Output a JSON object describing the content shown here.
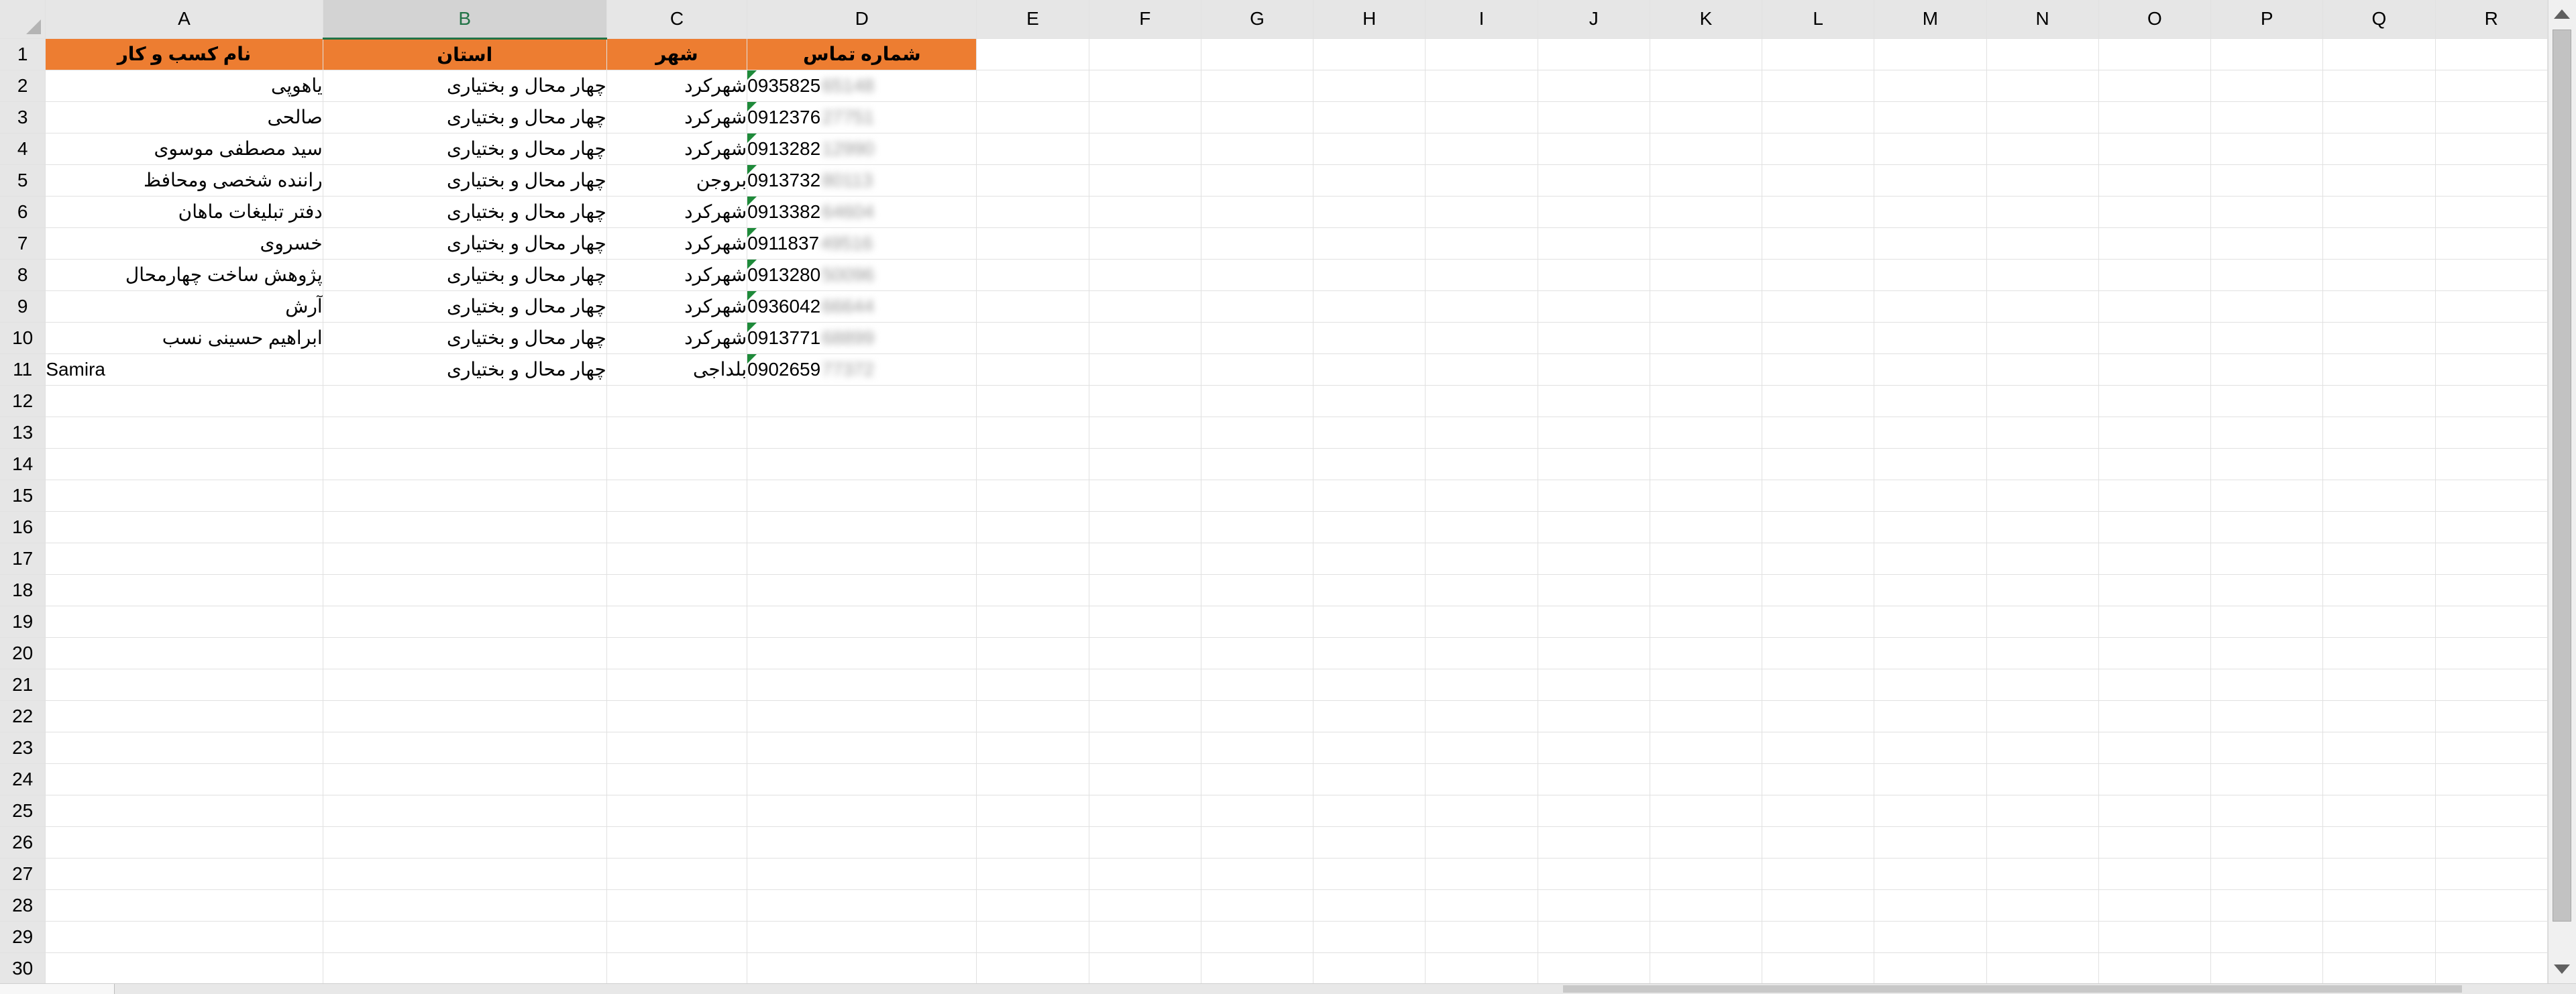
{
  "columns": [
    "A",
    "B",
    "C",
    "D",
    "E",
    "F",
    "G",
    "H",
    "I",
    "J",
    "K",
    "L",
    "M",
    "N",
    "O",
    "P",
    "Q",
    "R"
  ],
  "selected_column": "B",
  "header_row": {
    "business_name": "نام کسب و کار",
    "province": "استان",
    "city": "شهر",
    "phone": "شماره تماس"
  },
  "rows": [
    {
      "row": "2",
      "name": "یاهوپی",
      "province": "چهار محال و بختیاری",
      "city": "شهرکرد",
      "phone": "0935825",
      "phone_hidden": "65148"
    },
    {
      "row": "3",
      "name": "صالحی",
      "province": "چهار محال و بختیاری",
      "city": "شهرکرد",
      "phone": "0912376",
      "phone_hidden": "27751"
    },
    {
      "row": "4",
      "name": "سید مصطفی موسوی",
      "province": "چهار محال و بختیاری",
      "city": "شهرکرد",
      "phone": "0913282",
      "phone_hidden": "12990"
    },
    {
      "row": "5",
      "name": "راننده شخصی ومحافظ",
      "province": "چهار محال و بختیاری",
      "city": "بروجن",
      "phone": "0913732",
      "phone_hidden": "80113"
    },
    {
      "row": "6",
      "name": "دفتر تبلیغات ماهان",
      "province": "چهار محال و بختیاری",
      "city": "شهرکرد",
      "phone": "0913382",
      "phone_hidden": "64604"
    },
    {
      "row": "7",
      "name": "خسروی",
      "province": "چهار محال و بختیاری",
      "city": "شهرکرد",
      "phone": "0911837",
      "phone_hidden": "49516"
    },
    {
      "row": "8",
      "name": "پژوهش ساخت چهارمحال",
      "province": "چهار محال و بختیاری",
      "city": "شهرکرد",
      "phone": "0913280",
      "phone_hidden": "50096"
    },
    {
      "row": "9",
      "name": "آرش",
      "province": "چهار محال و بختیاری",
      "city": "شهرکرد",
      "phone": "0936042",
      "phone_hidden": "66644"
    },
    {
      "row": "10",
      "name": "ابراهیم حسینی نسب",
      "province": "چهار محال و بختیاری",
      "city": "شهرکرد",
      "phone": "0913771",
      "phone_hidden": "68899"
    },
    {
      "row": "11",
      "name": "Samira",
      "province": "چهار محال و بختیاری",
      "city": "بلداجی",
      "phone": "0902659",
      "phone_hidden": "77372"
    }
  ],
  "empty_rows": [
    "12",
    "13",
    "14",
    "15",
    "16",
    "17",
    "18",
    "19",
    "20",
    "21",
    "22",
    "23",
    "24",
    "25",
    "26",
    "27",
    "28",
    "29",
    "30"
  ],
  "colors": {
    "header_fill": "#ed7d31",
    "selected_header_text": "#217346",
    "comment_flag": "#1e8a3a"
  }
}
